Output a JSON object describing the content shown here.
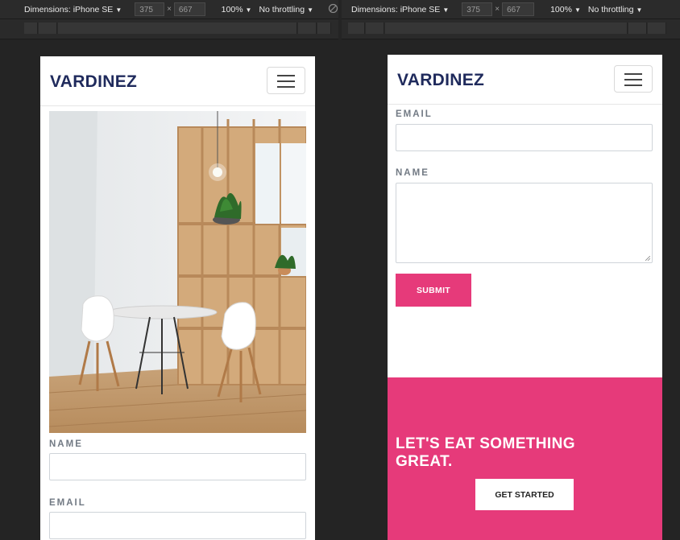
{
  "devtools": {
    "dimensions_label": "Dimensions: iPhone SE",
    "width": "375",
    "times": "×",
    "height": "667",
    "zoom": "100%",
    "throttle": "No throttling",
    "caret": "▼",
    "rotate_icon": "⃠"
  },
  "site": {
    "brand": "VARDINEZ"
  },
  "left": {
    "name_label": "NAME",
    "email_label": "EMAIL",
    "image_alt": "photo-of-table-and-chairs"
  },
  "right": {
    "email_label": "EMAIL",
    "name_label": "NAME",
    "submit_label": "SUBMIT",
    "cta_title": "LET'S EAT SOMETHING GREAT.",
    "cta_button": "GET STARTED"
  },
  "colors": {
    "brand": "#1f2a5c",
    "accent": "#e63a7a",
    "devtools_bg": "#242424"
  }
}
